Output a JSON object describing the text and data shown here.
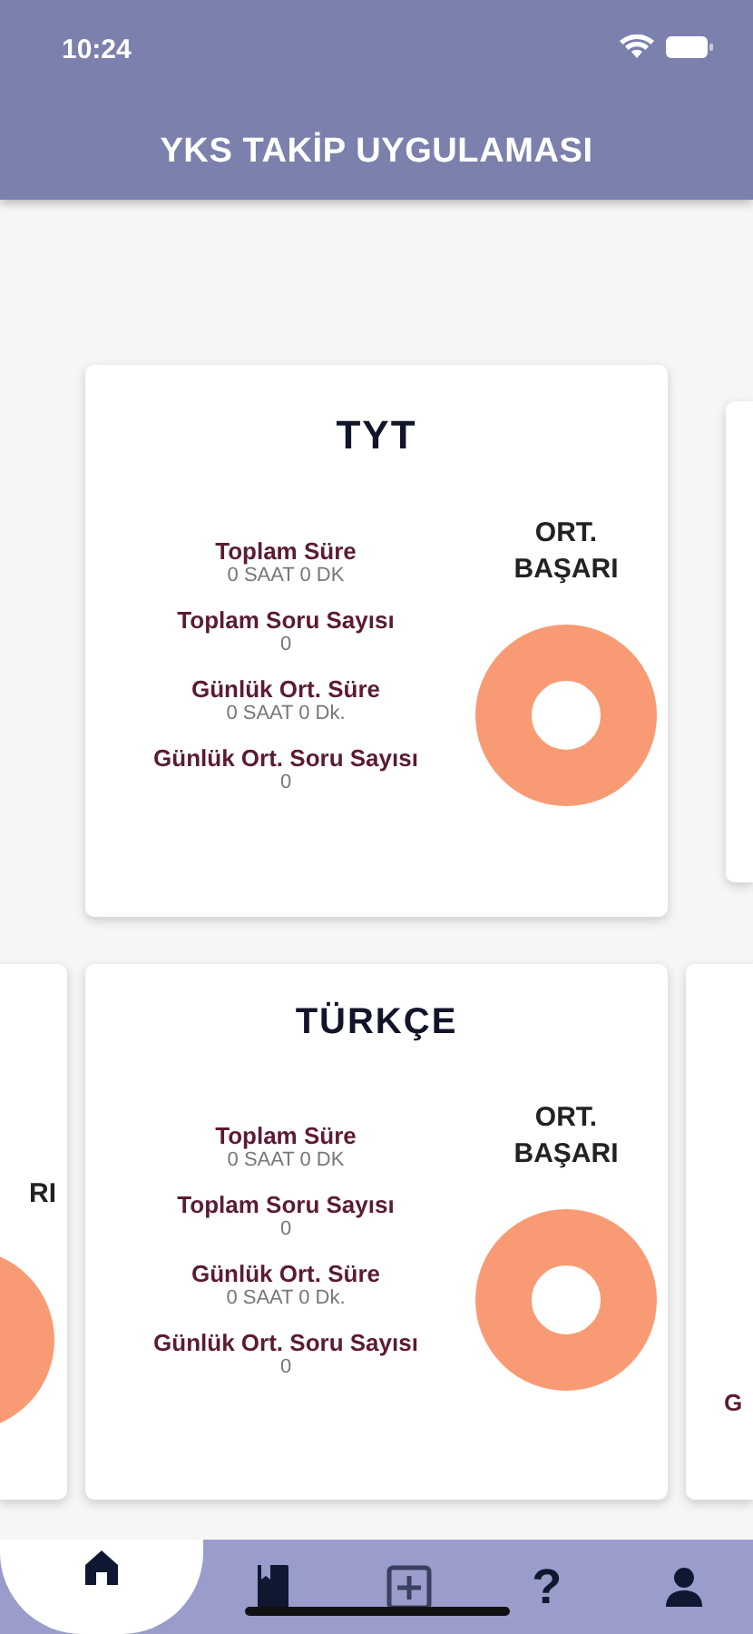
{
  "status_bar": {
    "time": "10:24"
  },
  "header": {
    "title": "YKS TAKİP UYGULAMASI"
  },
  "rows": [
    {
      "main": {
        "title": "TYT",
        "success_label": "ORT. BAŞARI",
        "stats": [
          {
            "label": "Toplam Süre",
            "value": "0 SAAT 0 DK"
          },
          {
            "label": "Toplam Soru Sayısı",
            "value": "0"
          },
          {
            "label": "Günlük Ort. Süre",
            "value": "0 SAAT 0 Dk."
          },
          {
            "label": "Günlük Ort. Soru Sayısı",
            "value": "0"
          }
        ]
      },
      "peeks": [
        {
          "kind": "right"
        }
      ]
    },
    {
      "main": {
        "title": "TÜRKÇE",
        "success_label": "ORT. BAŞARI",
        "stats": [
          {
            "label": "Toplam Süre",
            "value": "0 SAAT 0 DK"
          },
          {
            "label": "Toplam Soru Sayısı",
            "value": "0"
          },
          {
            "label": "Günlük Ort. Süre",
            "value": "0 SAAT 0 Dk."
          },
          {
            "label": "Günlük Ort. Soru Sayısı",
            "value": "0"
          }
        ]
      },
      "peeks": [
        {
          "kind": "left",
          "label": "RI"
        },
        {
          "kind": "right",
          "label": "G"
        }
      ]
    }
  ],
  "tabs": [
    {
      "kind": "home",
      "selected": true
    },
    {
      "kind": "book",
      "selected": false
    },
    {
      "kind": "plus",
      "selected": false
    },
    {
      "kind": "text",
      "text": "?",
      "selected": false
    },
    {
      "kind": "person",
      "selected": false
    }
  ]
}
